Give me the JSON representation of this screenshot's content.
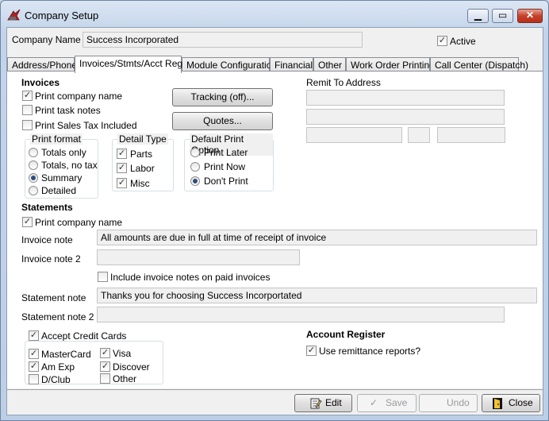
{
  "window": {
    "title": "Company Setup"
  },
  "header": {
    "company_name_label": "Company Name",
    "company_name_value": "Success Incorporated",
    "active_label": "Active",
    "active_checked": true
  },
  "tabs": [
    {
      "label": "Address/Phone"
    },
    {
      "label": "Invoices/Stmts/Acct Reg",
      "active": true
    },
    {
      "label": "Module Configuration"
    },
    {
      "label": "Financial"
    },
    {
      "label": "Other"
    },
    {
      "label": "Work Order Printing"
    },
    {
      "label": "Call Center (Dispatch)"
    }
  ],
  "invoices": {
    "heading": "Invoices",
    "print_company_name": {
      "label": "Print company name",
      "checked": true
    },
    "print_task_notes": {
      "label": "Print task notes",
      "checked": false
    },
    "print_sales_tax": {
      "label": "Print Sales Tax Included",
      "checked": false
    },
    "tracking_button": "Tracking (off)...",
    "quotes_button": "Quotes...",
    "print_format": {
      "title": "Print format",
      "options": [
        {
          "label": "Totals only",
          "selected": false
        },
        {
          "label": "Totals, no tax",
          "selected": false
        },
        {
          "label": "Summary",
          "selected": true
        },
        {
          "label": "Detailed",
          "selected": false
        }
      ]
    },
    "detail_type": {
      "title": "Detail Type",
      "options": [
        {
          "label": "Parts",
          "checked": true
        },
        {
          "label": "Labor",
          "checked": true
        },
        {
          "label": "Misc",
          "checked": true
        }
      ]
    },
    "default_print_option": {
      "title": "Default Print Option",
      "options": [
        {
          "label": "Print Later",
          "selected": false
        },
        {
          "label": "Print Now",
          "selected": false
        },
        {
          "label": "Don't Print",
          "selected": true
        }
      ]
    }
  },
  "remit": {
    "label": "Remit To Address"
  },
  "statements": {
    "heading": "Statements",
    "print_company_name": {
      "label": "Print company name",
      "checked": true
    },
    "invoice_note_label": "Invoice note",
    "invoice_note_value": "All amounts are due in full at time of receipt of invoice",
    "invoice_note2_label": "Invoice note 2",
    "invoice_note2_value": "",
    "include_notes": {
      "label": "Include invoice notes on paid invoices",
      "checked": false
    },
    "statement_note_label": "Statement note",
    "statement_note_value": "Thanks you for choosing Success Incorportated",
    "statement_note2_label": "Statement note 2",
    "statement_note2_value": ""
  },
  "credit_cards": {
    "accept": {
      "label": "Accept Credit Cards",
      "checked": true
    },
    "cards": [
      {
        "label": "MasterCard",
        "checked": true
      },
      {
        "label": "Visa",
        "checked": true
      },
      {
        "label": "Am Exp",
        "checked": true
      },
      {
        "label": "Discover",
        "checked": true
      },
      {
        "label": "D/Club",
        "checked": false
      },
      {
        "label": "Other",
        "checked": false
      }
    ]
  },
  "account_register": {
    "heading": "Account Register",
    "use_remittance": {
      "label": "Use remittance reports?",
      "checked": true
    }
  },
  "footer": {
    "edit": "Edit",
    "save": "Save",
    "undo": "Undo",
    "close": "Close"
  },
  "icons": {
    "app": "company-setup-icon",
    "edit": "edit-icon",
    "save": "save-check-icon",
    "close": "door-exit-icon"
  }
}
